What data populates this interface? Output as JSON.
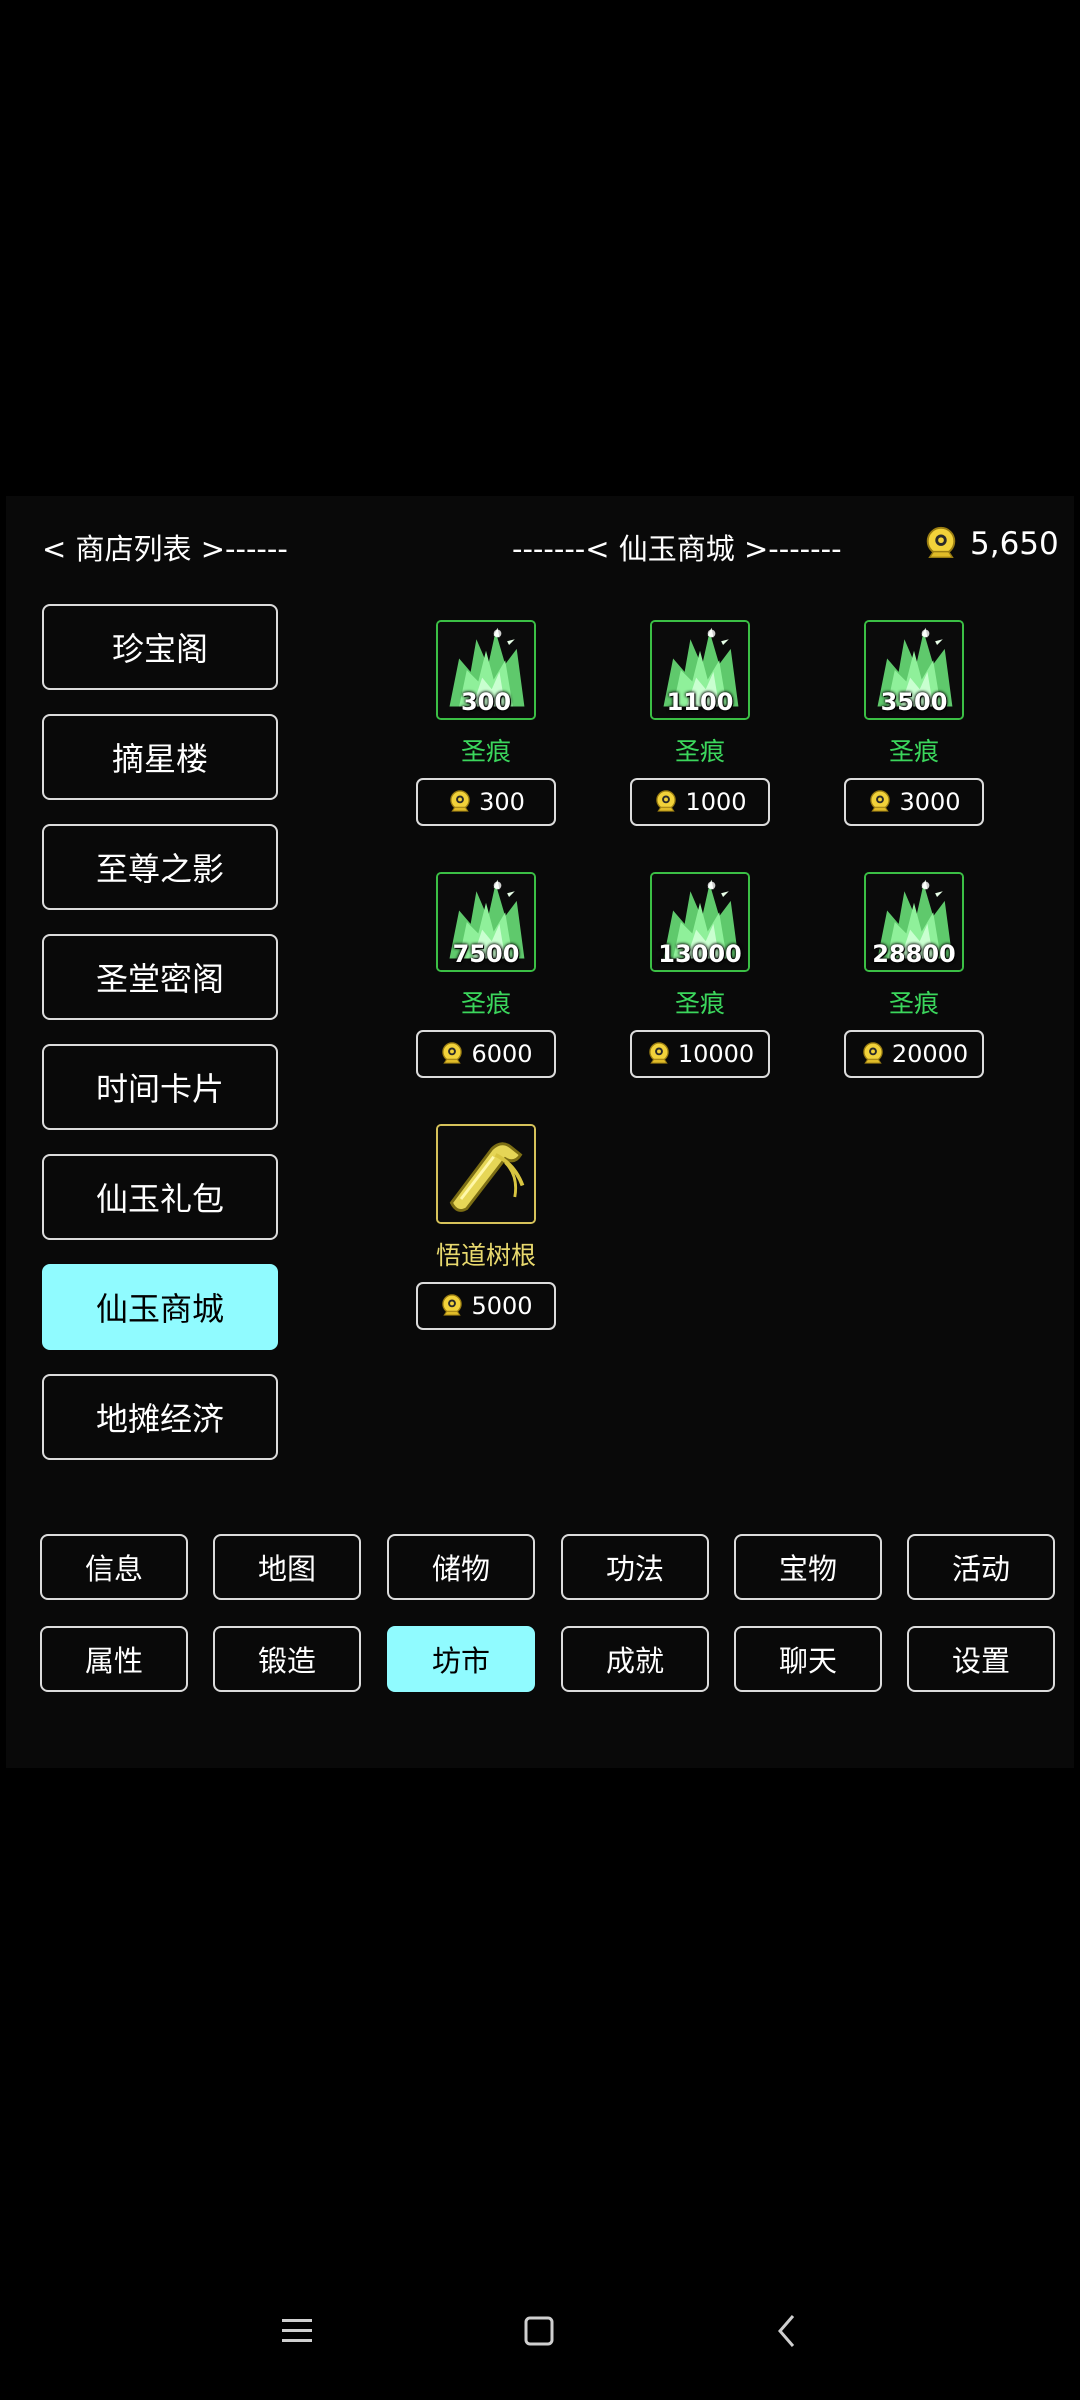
{
  "header": {
    "shop_list_label": "< 商店列表 >------",
    "current_shop_label": "-------< 仙玉商城 >-------",
    "currency_icon": "jade-coin-icon",
    "balance": "5,650"
  },
  "sidebar": {
    "items": [
      {
        "label": "珍宝阁"
      },
      {
        "label": "摘星楼"
      },
      {
        "label": "至尊之影"
      },
      {
        "label": "圣堂密阁"
      },
      {
        "label": "时间卡片"
      },
      {
        "label": "仙玉礼包"
      },
      {
        "label": "仙玉商城",
        "selected": true
      },
      {
        "label": "地摊经济"
      }
    ]
  },
  "shop": {
    "items": [
      {
        "icon": "green-crystal-icon",
        "qty": "300",
        "name": "圣痕",
        "price": "300"
      },
      {
        "icon": "green-crystal-icon",
        "qty": "1100",
        "name": "圣痕",
        "price": "1000"
      },
      {
        "icon": "green-crystal-icon",
        "qty": "3500",
        "name": "圣痕",
        "price": "3000"
      },
      {
        "icon": "green-crystal-icon",
        "qty": "7500",
        "name": "圣痕",
        "price": "6000"
      },
      {
        "icon": "green-crystal-icon",
        "qty": "13000",
        "name": "圣痕",
        "price": "10000"
      },
      {
        "icon": "green-crystal-icon",
        "qty": "28800",
        "name": "圣痕",
        "price": "20000"
      },
      {
        "icon": "tree-root-icon",
        "qty": "",
        "name": "悟道树根",
        "price": "5000"
      }
    ]
  },
  "bottom_nav": {
    "row1": [
      {
        "label": "信息"
      },
      {
        "label": "地图"
      },
      {
        "label": "储物"
      },
      {
        "label": "功法"
      },
      {
        "label": "宝物"
      },
      {
        "label": "活动"
      }
    ],
    "row2": [
      {
        "label": "属性"
      },
      {
        "label": "锻造"
      },
      {
        "label": "坊市",
        "selected": true
      },
      {
        "label": "成就"
      },
      {
        "label": "聊天"
      },
      {
        "label": "设置"
      }
    ]
  },
  "system_nav": {
    "menu_icon": "menu-icon",
    "home_icon": "home-square-icon",
    "back_icon": "back-chevron-icon"
  },
  "colors": {
    "background": "#000000",
    "accent_cyan": "#90fbff",
    "item_green": "#3bd65c",
    "item_gold": "#e8d96e",
    "coin_gold": "#f2d23a"
  }
}
